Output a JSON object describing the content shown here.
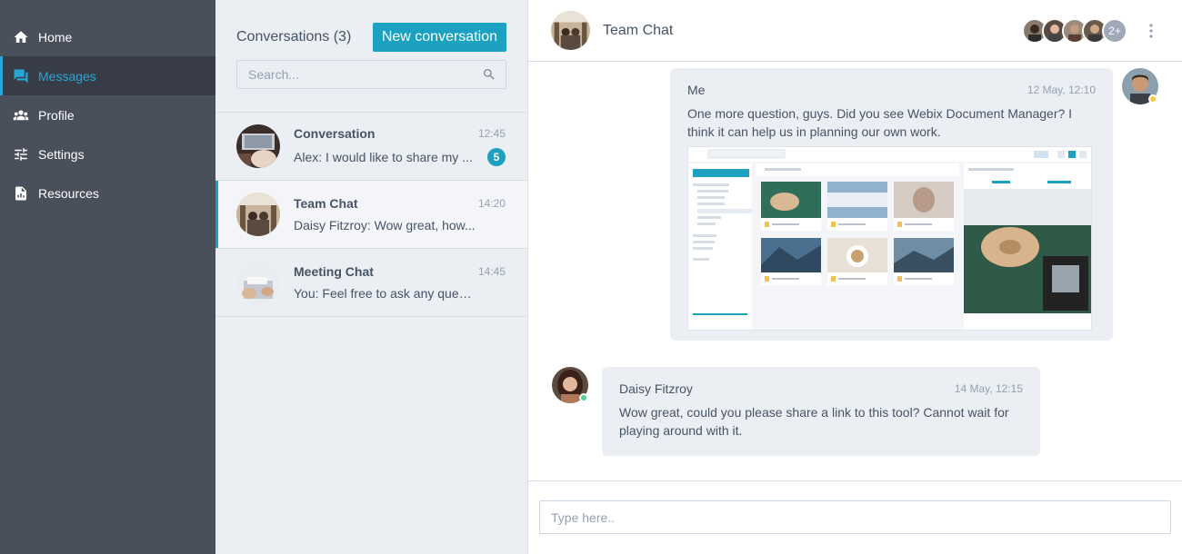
{
  "sidebar": {
    "items": [
      {
        "label": "Home",
        "icon": "home-icon"
      },
      {
        "label": "Messages",
        "icon": "messages-icon",
        "active": true
      },
      {
        "label": "Profile",
        "icon": "users-icon"
      },
      {
        "label": "Settings",
        "icon": "sliders-icon"
      },
      {
        "label": "Resources",
        "icon": "file-chart-icon"
      }
    ]
  },
  "conversations": {
    "title": "Conversations (3)",
    "new_button": "New conversation",
    "search_placeholder": "Search...",
    "items": [
      {
        "name": "Conversation",
        "time": "12:45",
        "message": "Alex: I would like to share my ...",
        "badge": "5"
      },
      {
        "name": "Team Chat",
        "time": "14:20",
        "message": "Daisy Fitzroy: Wow great, how...",
        "active": true
      },
      {
        "name": "Meeting Chat",
        "time": "14:45",
        "message": "You: Feel free to ask any ques..."
      }
    ]
  },
  "chat": {
    "title": "Team Chat",
    "members_more": "2+",
    "messages": [
      {
        "author": "Me",
        "date": "12 May, 12:10",
        "text": "One more question, guys. Did you see Webix Document Manager? I think it can help us in planning our own work."
      },
      {
        "author": "Daisy Fitzroy",
        "date": "14 May, 12:15",
        "text": "Wow great, could you please share a link to this tool? Cannot wait for playing around with it."
      }
    ],
    "input_placeholder": "Type here.."
  },
  "colors": {
    "sidebar_bg": "#4a4f5c",
    "accent": "#1ca1c1",
    "list_bg": "#ebeef3",
    "status_online": "#55cd97",
    "status_away": "#fec740"
  }
}
